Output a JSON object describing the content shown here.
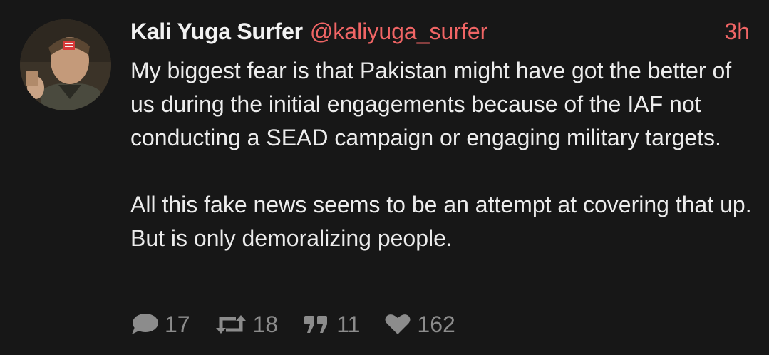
{
  "post": {
    "author": {
      "display_name": "Kali Yuga Surfer",
      "handle": "@kaliyuga_surfer"
    },
    "timestamp": "3h",
    "paragraphs": [
      "My biggest fear is that Pakistan might have got the better of us during the initial engagements because of the IAF not conducting a SEAD campaign or engaging military targets.",
      "All this fake news seems to be an attempt at covering that up. But is only demoralizing people."
    ],
    "stats": {
      "replies": "17",
      "reposts": "18",
      "quotes": "11",
      "likes": "162"
    },
    "icons": {
      "replies": "speech-bubble-icon",
      "reposts": "repost-arrows-icon",
      "quotes": "quote-marks-icon",
      "likes": "heart-icon"
    }
  },
  "colors": {
    "background": "#171717",
    "accent": "#f06565",
    "text": "#ececec",
    "muted": "#8c8c8c"
  }
}
